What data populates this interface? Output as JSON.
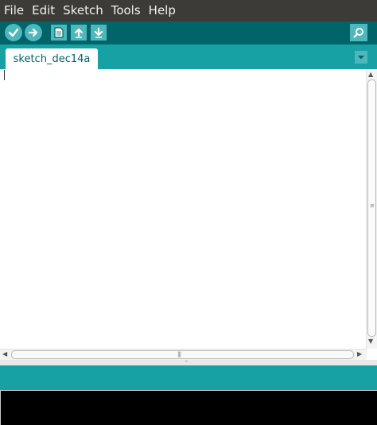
{
  "menubar": {
    "items": [
      "File",
      "Edit",
      "Sketch",
      "Tools",
      "Help"
    ]
  },
  "toolbar": {
    "buttons": [
      {
        "name": "verify",
        "icon": "checkmark-icon"
      },
      {
        "name": "upload",
        "icon": "arrow-right-icon"
      },
      {
        "name": "new",
        "icon": "new-file-icon"
      },
      {
        "name": "open",
        "icon": "arrow-up-icon"
      },
      {
        "name": "save",
        "icon": "arrow-down-icon"
      },
      {
        "name": "serial-monitor",
        "icon": "magnifier-icon"
      }
    ]
  },
  "tabs": {
    "active": "sketch_dec14a",
    "menu_icon": "chevron-down-icon"
  },
  "colors": {
    "menubar": "#3c3b37",
    "toolbar": "#006468",
    "accent": "#17a1a5",
    "button": "#4db7bb",
    "console": "#000000"
  }
}
